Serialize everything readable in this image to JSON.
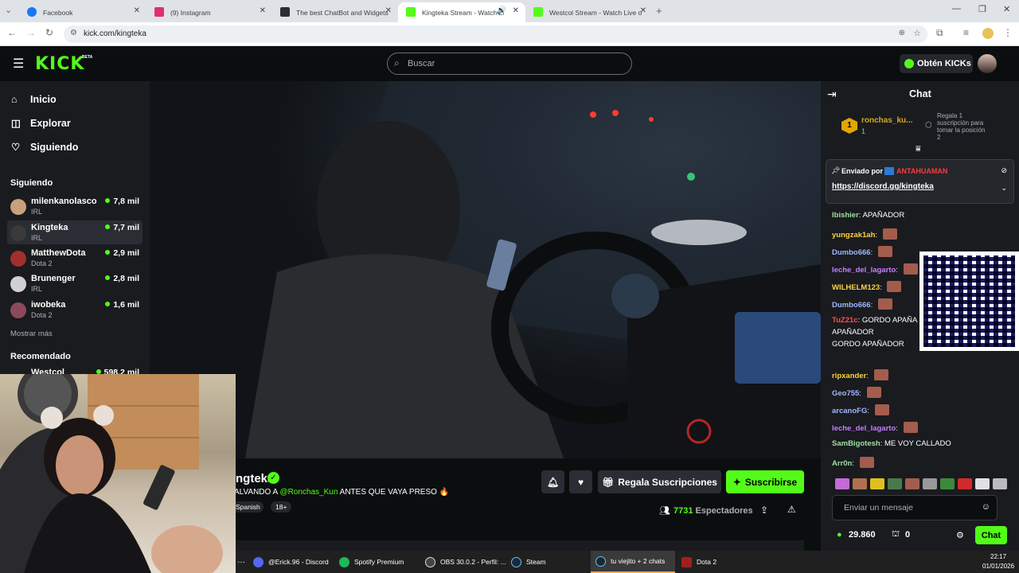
{
  "browser": {
    "tabs": [
      {
        "title": "Facebook",
        "color": "#1877f2"
      },
      {
        "title": "(9) Instagram",
        "color": "#e1306c"
      },
      {
        "title": "The best ChatBot and Widgets",
        "color": "#2d2d2d"
      },
      {
        "title": "Kingteka Stream - Watch Li",
        "color": "#53fc18"
      },
      {
        "title": "Westcol Stream - Watch Live o",
        "color": "#53fc18"
      }
    ],
    "url": "kick.com/kingteka"
  },
  "kick": {
    "logo": "KICK",
    "beta": "BETA",
    "search_placeholder": "Buscar",
    "get_kicks": "Obtén KICKs"
  },
  "sidebar": {
    "nav": [
      {
        "label": "Inicio",
        "icon": "home-icon"
      },
      {
        "label": "Explorar",
        "icon": "compass-icon"
      },
      {
        "label": "Siguiendo",
        "icon": "heart-icon"
      }
    ],
    "following_title": "Siguiendo",
    "following": [
      {
        "name": "milenkanolasco",
        "category": "IRL",
        "viewers": "7,8 mil",
        "color": "#c9a07c"
      },
      {
        "name": "Kingteka",
        "category": "IRL",
        "viewers": "7,7 mil",
        "color": "#3a3a3a"
      },
      {
        "name": "MatthewDota",
        "category": "Dota 2",
        "viewers": "2,9 mil",
        "color": "#a0302c"
      },
      {
        "name": "Brunenger",
        "category": "IRL",
        "viewers": "2,8 mil",
        "color": "#d0d0d0"
      },
      {
        "name": "iwobeka",
        "category": "Dota 2",
        "viewers": "1,6 mil",
        "color": "#8a4a5a"
      }
    ],
    "show_more": "Mostrar más",
    "recommended_title": "Recomendado",
    "recommended": [
      {
        "name": "Westcol",
        "viewers": "598,2 mil"
      }
    ]
  },
  "stream": {
    "channel": "ngteka",
    "title_prefix": "ALVANDO A ",
    "title_mention": "@Ronchas_Kun",
    "title_suffix": " ANTES QUE VAYA PRESO 🔥",
    "tags": [
      "Spanish",
      "18+"
    ],
    "gift_button": "Regala Suscripciones",
    "subscribe_button": "Suscribirse",
    "viewers": "7731",
    "viewers_label": "Espectadores"
  },
  "chat": {
    "title": "Chat",
    "leader": {
      "rank": "1",
      "name": "ronchas_ku...",
      "count": "1"
    },
    "gift_prompt": [
      "Regala 1",
      "suscripción para",
      "tomar la posición",
      "2"
    ],
    "pinned_label": "Enviado por",
    "pinned_user": "ANTAHUAMAN",
    "pinned_link": "https://discord.gg/kingteka",
    "messages": [
      {
        "user": "lbishier",
        "color": "#9fdfa0",
        "text": "APAÑADOR",
        "emote": false
      },
      {
        "user": "yungzak1ah",
        "color": "#ffd23f",
        "text": "",
        "emote": true
      },
      {
        "user": "Dumbo666",
        "color": "#9eb8ff",
        "text": "",
        "emote": true
      },
      {
        "user": "leche_del_lagarto",
        "color": "#c77dff",
        "text": "",
        "emote": true
      },
      {
        "user": "WILHELM123",
        "color": "#ffd23f",
        "text": "",
        "emote": true
      },
      {
        "user": "Dumbo666",
        "color": "#9eb8ff",
        "text": "",
        "emote": true
      },
      {
        "user": "TuZ21c",
        "color": "#ff4d4d",
        "text": "GORDO APAÑA",
        "emote": false
      },
      {
        "user": "",
        "color": "#ffffff",
        "text": "APAÑADOR",
        "emote": false
      },
      {
        "user": "",
        "color": "#ffffff",
        "text": "GORDO APAÑADOR",
        "emote": false
      },
      {
        "user": "ripxander",
        "color": "#ffd23f",
        "text": "",
        "emote": true
      },
      {
        "user": "Geo755",
        "color": "#9eb8ff",
        "text": "",
        "emote": true
      },
      {
        "user": "arcanoFG",
        "color": "#9eb8ff",
        "text": "",
        "emote": true
      },
      {
        "user": "leche_del_lagarto",
        "color": "#c77dff",
        "text": "",
        "emote": true
      },
      {
        "user": "SamBigotesh",
        "color": "#9fdfa0",
        "text": "ME VOY CALLADO",
        "emote": false
      },
      {
        "user": "Arr0n",
        "color": "#9fdfa0",
        "text": "",
        "emote": true
      }
    ],
    "input_placeholder": "Enviar un mensaje",
    "kicks_balance": "29.860",
    "store_count": "0",
    "send_button": "Chat"
  },
  "taskbar": {
    "items": [
      {
        "label": "@Erick.96 - Discord",
        "color": "#5865f2"
      },
      {
        "label": "Spotify Premium",
        "color": "#1db954"
      },
      {
        "label": "OBS 30.0.2 - Perfil: ...",
        "color": "#444"
      },
      {
        "label": "Steam",
        "color": "#1b2838"
      },
      {
        "label": "tu viejito + 2 chats",
        "color": "#1b2838"
      },
      {
        "label": "Dota 2",
        "color": "#a02020"
      }
    ],
    "time": "22:17",
    "date": "01/01/2026"
  },
  "colors": {
    "accent": "#53fc18",
    "bg": "#0b0e0f",
    "panel": "#191b1f"
  }
}
